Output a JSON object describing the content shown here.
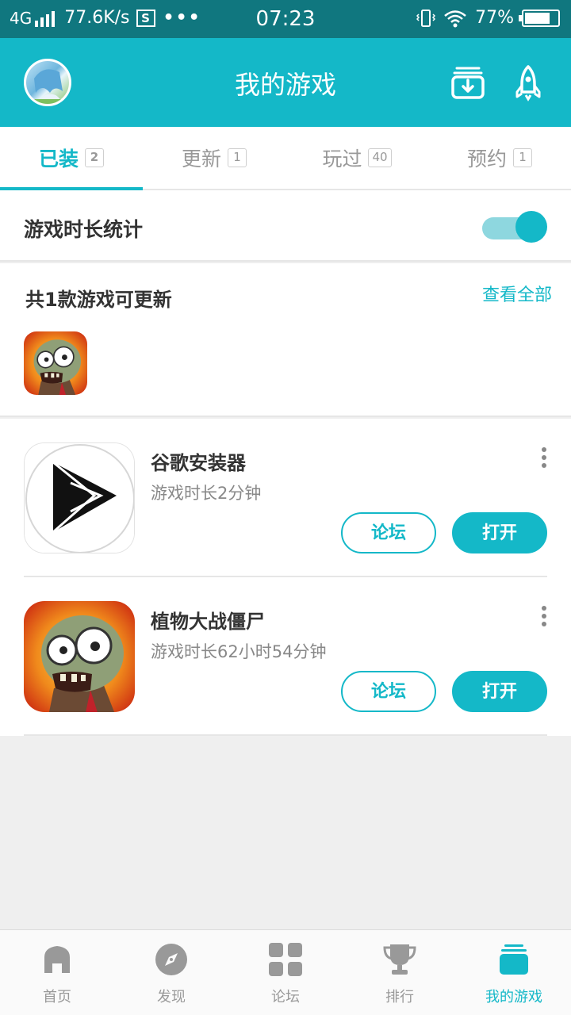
{
  "status_bar": {
    "network": "4G",
    "speed": "77.6K/s",
    "s_icon": "S",
    "dots": "•••",
    "time": "07:23",
    "battery": "77%"
  },
  "header": {
    "title": "我的游戏",
    "avatar_icon": "avatar",
    "download_icon": "download-manager-icon",
    "rocket_icon": "rocket-icon"
  },
  "tabs": [
    {
      "label": "已装",
      "count": "2",
      "active": true
    },
    {
      "label": "更新",
      "count": "1",
      "active": false
    },
    {
      "label": "玩过",
      "count": "40",
      "active": false
    },
    {
      "label": "预约",
      "count": "1",
      "active": false
    }
  ],
  "stat_toggle": {
    "label": "游戏时长统计",
    "enabled": true
  },
  "updates": {
    "title": "共1款游戏可更新",
    "view_all": "查看全部"
  },
  "games": [
    {
      "name": "谷歌安装器",
      "time": "游戏时长2分钟",
      "forum_label": "论坛",
      "open_label": "打开"
    },
    {
      "name": "植物大战僵尸",
      "time": "游戏时长62小时54分钟",
      "forum_label": "论坛",
      "open_label": "打开"
    }
  ],
  "bottom_nav": [
    {
      "label": "首页",
      "icon": "home-icon"
    },
    {
      "label": "发现",
      "icon": "compass-icon"
    },
    {
      "label": "论坛",
      "icon": "grid-icon"
    },
    {
      "label": "排行",
      "icon": "trophy-icon"
    },
    {
      "label": "我的游戏",
      "icon": "my-games-icon",
      "active": true
    }
  ],
  "colors": {
    "accent": "#14b8c8",
    "status_bar": "#10777f"
  }
}
